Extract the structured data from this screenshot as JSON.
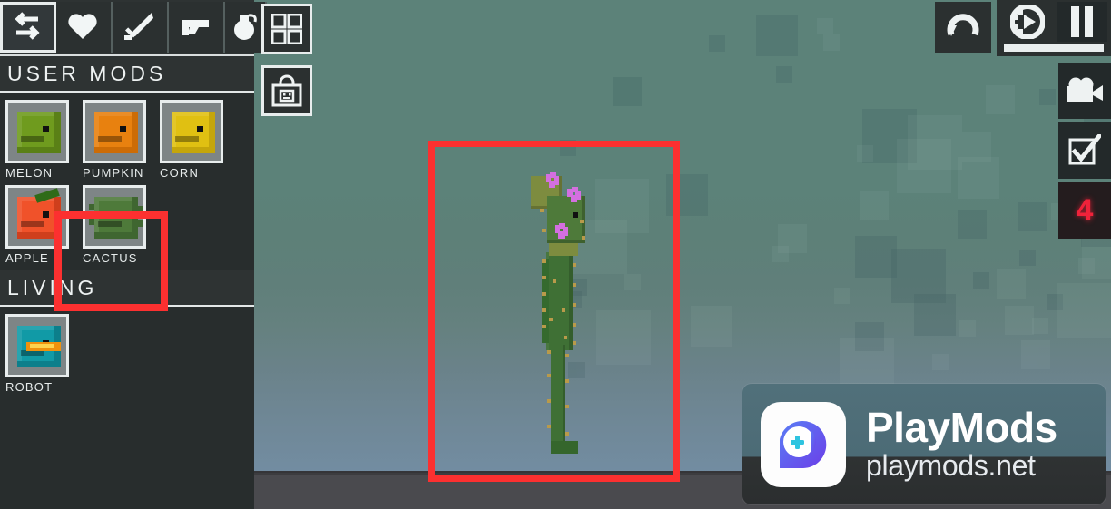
{
  "app": {
    "title": "People Playground - Mod Spawn Menu",
    "background_color": "#5d8279",
    "ground_color": "#4a4a4e",
    "accent_red": "#fc3030",
    "counter_red": "#f0223a"
  },
  "toolbar": {
    "items": [
      {
        "label": "Transfer",
        "icon": "swap-arrows-icon",
        "selected": true
      },
      {
        "label": "Health",
        "icon": "heart-icon",
        "selected": false
      },
      {
        "label": "Melee",
        "icon": "sword-icon",
        "selected": false
      },
      {
        "label": "Firearms",
        "icon": "pistol-icon",
        "selected": false
      },
      {
        "label": "Explosives",
        "icon": "grenade-icon",
        "selected": false
      }
    ]
  },
  "floating_buttons": [
    {
      "name": "grid-menu",
      "icon": "grid-four-squares-icon",
      "label": "Grid Menu"
    },
    {
      "name": "shop-bag",
      "icon": "shopping-bag-icon",
      "label": "Mod Shop"
    }
  ],
  "sidebar": {
    "sections": [
      {
        "title": "USER MODS",
        "items": [
          {
            "label": "MELON",
            "icon": "melon-block-icon",
            "color": "#6f9b1e",
            "shade": "#5a8016",
            "highlighted": false
          },
          {
            "label": "PUMPKIN",
            "icon": "pumpkin-block-icon",
            "color": "#e8810f",
            "shade": "#cc6c06",
            "highlighted": false
          },
          {
            "label": "CORN",
            "icon": "corn-block-icon",
            "color": "#e0c012",
            "shade": "#c5a60b",
            "highlighted": false
          },
          {
            "label": "APPLE",
            "icon": "apple-block-icon",
            "color": "#f0522a",
            "shade": "#cf3f1c",
            "highlighted": false
          },
          {
            "label": "CACTUS",
            "icon": "cactus-block-icon",
            "color": "#4e7a3a",
            "shade": "#3f6630",
            "highlighted": true
          }
        ]
      },
      {
        "title": "LIVING",
        "items": [
          {
            "label": "ROBOT",
            "icon": "robot-head-icon",
            "color": "#119aa6",
            "shade": "#0c7f8b",
            "highlighted": false
          }
        ]
      }
    ]
  },
  "top_right_controls": {
    "undo": {
      "label": "Undo",
      "icon": "undo-arrow-icon"
    },
    "slow_motion": {
      "label": "Slow Motion",
      "icon": "slow-motion-icon"
    },
    "pause": {
      "label": "Pause",
      "icon": "pause-icon"
    },
    "time_bar_value": 100
  },
  "right_panel": {
    "buttons": [
      {
        "name": "camera",
        "label": "Camera",
        "icon": "video-camera-icon"
      },
      {
        "name": "select",
        "label": "Select",
        "icon": "checkbox-checked-icon"
      },
      {
        "name": "count",
        "label": "Object Count",
        "icon": "counter-icon",
        "value": "4"
      }
    ]
  },
  "annotations": [
    {
      "name": "spawned-cactus-highlight",
      "shape": "rectangle",
      "color": "#fc3030"
    },
    {
      "name": "cactus-mod-entry-highlight",
      "shape": "rectangle",
      "color": "#fc3030"
    }
  ],
  "spawned_entity": {
    "name": "cactus-ragdoll",
    "description": "Tall green cactus humanoid with pink flowers and spines"
  },
  "watermark": {
    "title": "PlayMods",
    "subtitle": "playmods.net",
    "logo_icon": "playmods-logo-icon"
  }
}
